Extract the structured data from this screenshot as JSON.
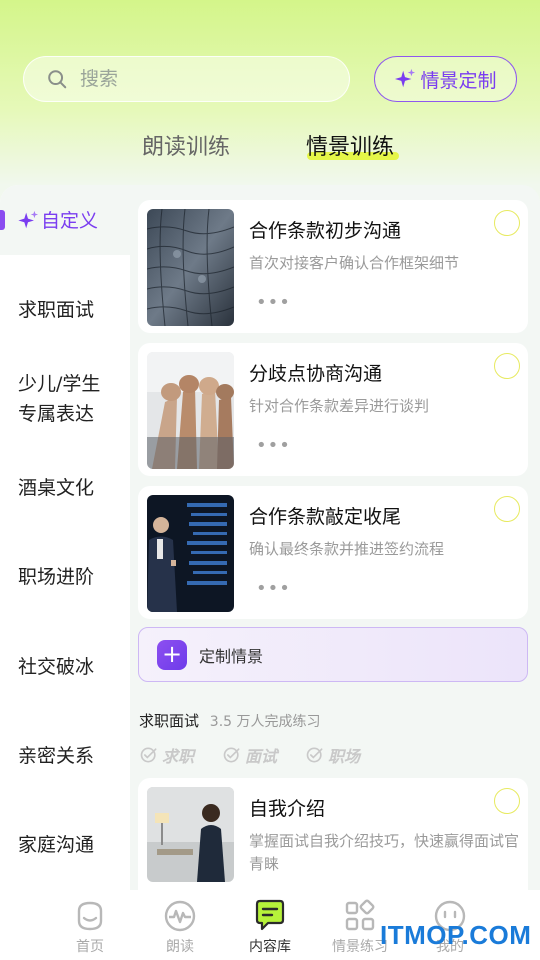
{
  "search": {
    "placeholder": "搜索"
  },
  "custom_button": {
    "label": "情景定制"
  },
  "tabs": [
    {
      "label": "朗读训练",
      "active": false
    },
    {
      "label": "情景训练",
      "active": true
    }
  ],
  "sidebar": {
    "active": "自定义",
    "items": [
      "求职面试",
      "少儿/学生\n专属表达",
      "酒桌文化",
      "职场进阶",
      "社交破冰",
      "亲密关系",
      "家庭沟通"
    ]
  },
  "cards": [
    {
      "title": "合作条款初步沟通",
      "desc": "首次对接客户确认合作框架细节",
      "more": "•••"
    },
    {
      "title": "分歧点协商沟通",
      "desc": "针对合作条款差异进行谈判",
      "more": "•••"
    },
    {
      "title": "合作条款敲定收尾",
      "desc": "确认最终条款并推进签约流程",
      "more": "•••"
    }
  ],
  "make_scene": {
    "label": "定制情景",
    "icon": "+"
  },
  "section": {
    "title": "求职面试",
    "count": "3.5 万人完成练习"
  },
  "tags": [
    "求职",
    "面试",
    "职场"
  ],
  "interview_card": {
    "title": "自我介绍",
    "desc": "掌握面试自我介绍技巧，快速赢得面试官青睐"
  },
  "nav": [
    {
      "label": "首页",
      "icon": "smile-face-icon",
      "active": false
    },
    {
      "label": "朗读",
      "icon": "waveform-icon",
      "active": false
    },
    {
      "label": "内容库",
      "icon": "chat-bubble-icon",
      "active": true
    },
    {
      "label": "情景练习",
      "icon": "grid-apps-icon",
      "active": false
    },
    {
      "label": "我的",
      "icon": "profile-face-icon",
      "active": false
    }
  ],
  "watermark": "ITMOP.COM",
  "colors": {
    "accent": "#7a3df0",
    "lime": "#e5f648",
    "active_nav": "#b6f23a"
  }
}
